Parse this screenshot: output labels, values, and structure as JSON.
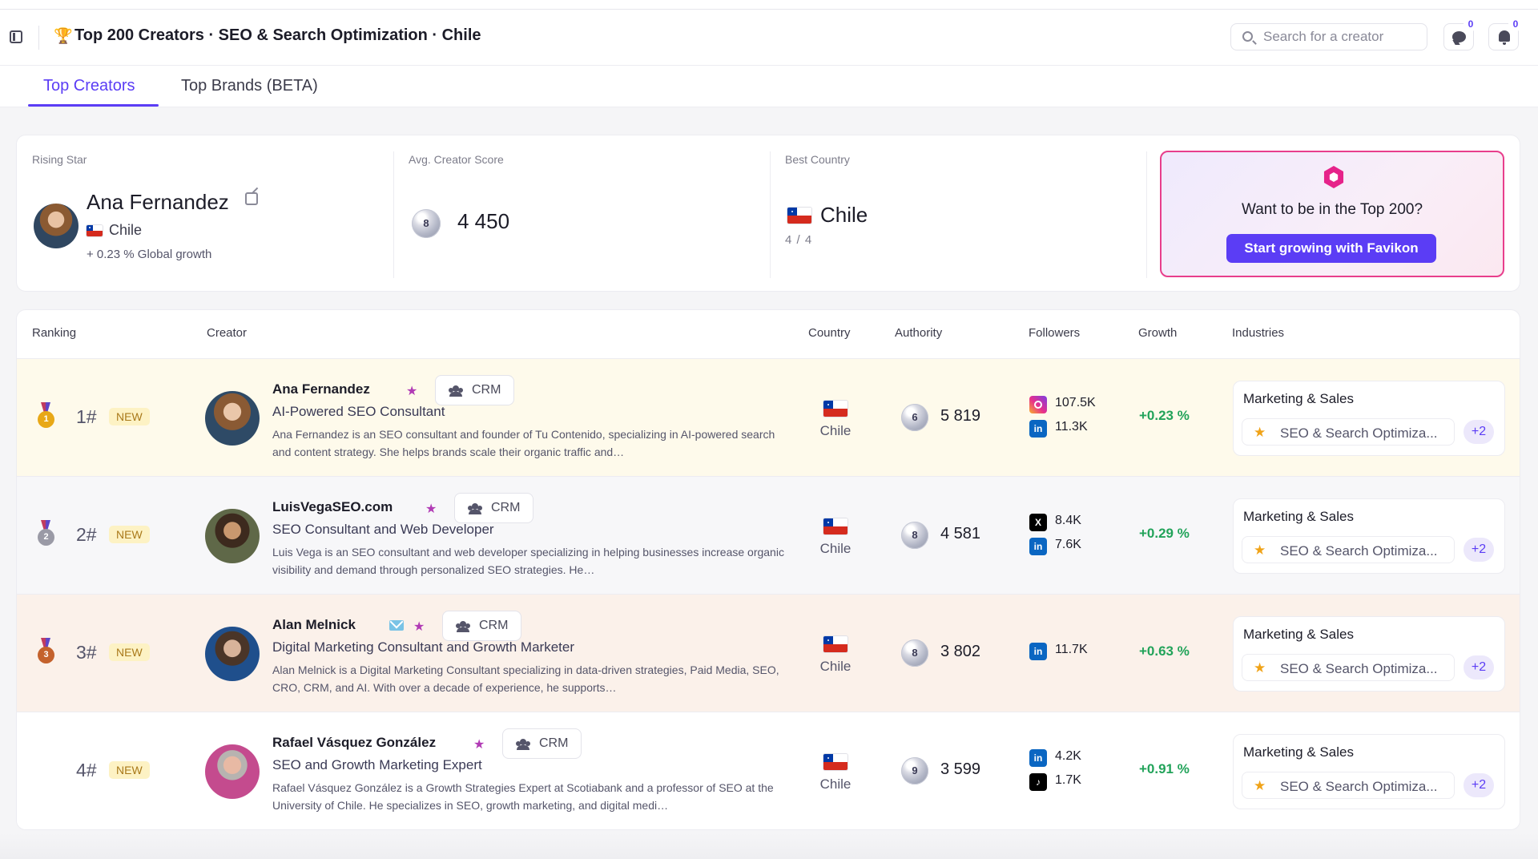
{
  "header": {
    "title": "Top 200 Creators · SEO & Search Optimization · Chile",
    "search_placeholder": "Search for a creator",
    "messages_count": "0",
    "notifications_count": "0"
  },
  "tabs": [
    {
      "label": "Top Creators",
      "active": true
    },
    {
      "label": "Top Brands (BETA)",
      "active": false
    }
  ],
  "stats": {
    "rising_star": {
      "label": "Rising Star",
      "name": "Ana Fernandez",
      "country": "Chile",
      "growth": "+ 0.23 % Global growth"
    },
    "avg_score": {
      "label": "Avg. Creator Score",
      "badge": "8",
      "value": "4 450"
    },
    "best_country": {
      "label": "Best Country",
      "country": "Chile",
      "count": "4 / 4"
    },
    "cta": {
      "title": "Want to be in the Top 200?",
      "button": "Start growing with Favikon"
    }
  },
  "table": {
    "columns": [
      "Ranking",
      "Creator",
      "Country",
      "Authority",
      "Followers",
      "Growth",
      "Industries"
    ],
    "rows": [
      {
        "medal": "1",
        "rank": "1#",
        "badge": "NEW",
        "name": "Ana Fernandez",
        "crm": "CRM",
        "title": "AI-Powered SEO Consultant",
        "description": "Ana Fernandez is an SEO consultant and founder of Tu Contenido, specializing in AI-powered search and content strategy. She helps brands scale their organic traffic and…",
        "country": "Chile",
        "score_badge": "6",
        "authority": "5 819",
        "networks": [
          {
            "icon": "instagram-icon",
            "count": "107.5K"
          },
          {
            "icon": "linkedin-icon",
            "count": "11.3K"
          }
        ],
        "growth": "+0.23 %",
        "industry": "Marketing & Sales",
        "sub_industry": "SEO & Search Optimiza...",
        "more": "+2"
      },
      {
        "medal": "2",
        "rank": "2#",
        "badge": "NEW",
        "name": "LuisVegaSEO.com",
        "crm": "CRM",
        "title": "SEO Consultant and Web Developer",
        "description": "Luis Vega is an SEO consultant and web developer specializing in helping businesses increase organic visibility and demand through personalized SEO strategies. He…",
        "country": "Chile",
        "score_badge": "8",
        "authority": "4 581",
        "networks": [
          {
            "icon": "x-icon",
            "count": "8.4K"
          },
          {
            "icon": "linkedin-icon",
            "count": "7.6K"
          }
        ],
        "growth": "+0.29 %",
        "industry": "Marketing & Sales",
        "sub_industry": "SEO & Search Optimiza...",
        "more": "+2"
      },
      {
        "medal": "3",
        "rank": "3#",
        "badge": "NEW",
        "name": "Alan Melnick",
        "crm": "CRM",
        "title": "Digital Marketing Consultant and Growth Marketer",
        "description": "Alan Melnick is a Digital Marketing Consultant specializing in data-driven strategies, Paid Media, SEO, CRO, CRM, and AI. With over a decade of experience, he supports…",
        "country": "Chile",
        "score_badge": "8",
        "authority": "3 802",
        "networks": [
          {
            "icon": "linkedin-icon",
            "count": "11.7K"
          }
        ],
        "growth": "+0.63 %",
        "industry": "Marketing & Sales",
        "sub_industry": "SEO & Search Optimiza...",
        "more": "+2"
      },
      {
        "medal": "",
        "rank": "4#",
        "badge": "NEW",
        "name": "Rafael Vásquez González",
        "crm": "CRM",
        "title": "SEO and Growth Marketing Expert",
        "description": "Rafael Vásquez González is a Growth Strategies Expert at Scotiabank and a professor of SEO at the University of Chile. He specializes in SEO, growth marketing, and digital medi…",
        "country": "Chile",
        "score_badge": "9",
        "authority": "3 599",
        "networks": [
          {
            "icon": "linkedin-icon",
            "count": "4.2K"
          },
          {
            "icon": "tiktok-icon",
            "count": "1.7K"
          }
        ],
        "growth": "+0.91 %",
        "industry": "Marketing & Sales",
        "sub_industry": "SEO & Search Optimiza...",
        "more": "+2"
      }
    ]
  },
  "colors": {
    "accent": "#5b3df5",
    "growth_green": "#22a35a",
    "cta_border": "#e83e8c",
    "row1_bg": "#fefaeb",
    "row3_bg": "#fbf1ea",
    "new_badge_bg": "#fdf2c4"
  }
}
